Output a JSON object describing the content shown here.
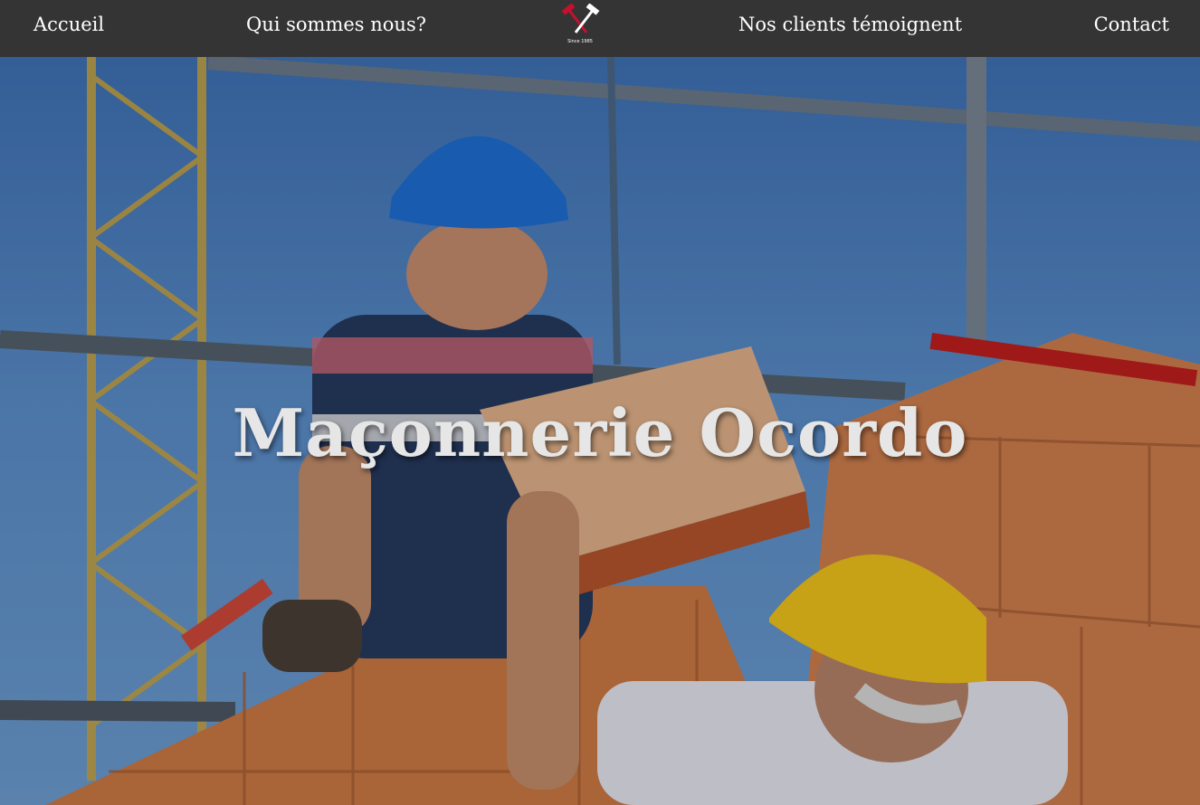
{
  "nav": {
    "items": [
      {
        "label": "Accueil"
      },
      {
        "label": "Qui sommes nous?"
      },
      {
        "label": "Nos clients témoignent"
      },
      {
        "label": "Contact"
      }
    ],
    "logo": {
      "icon": "hammer-icon",
      "caption": "Since 1985",
      "accent": "#c8102e"
    }
  },
  "hero": {
    "title": "Maçonnerie Ocordo",
    "image": "masons-laying-bricks-photo"
  },
  "colors": {
    "nav_bg": "#343434",
    "nav_text": "#ffffff",
    "title_text": "#e6e6e6"
  }
}
